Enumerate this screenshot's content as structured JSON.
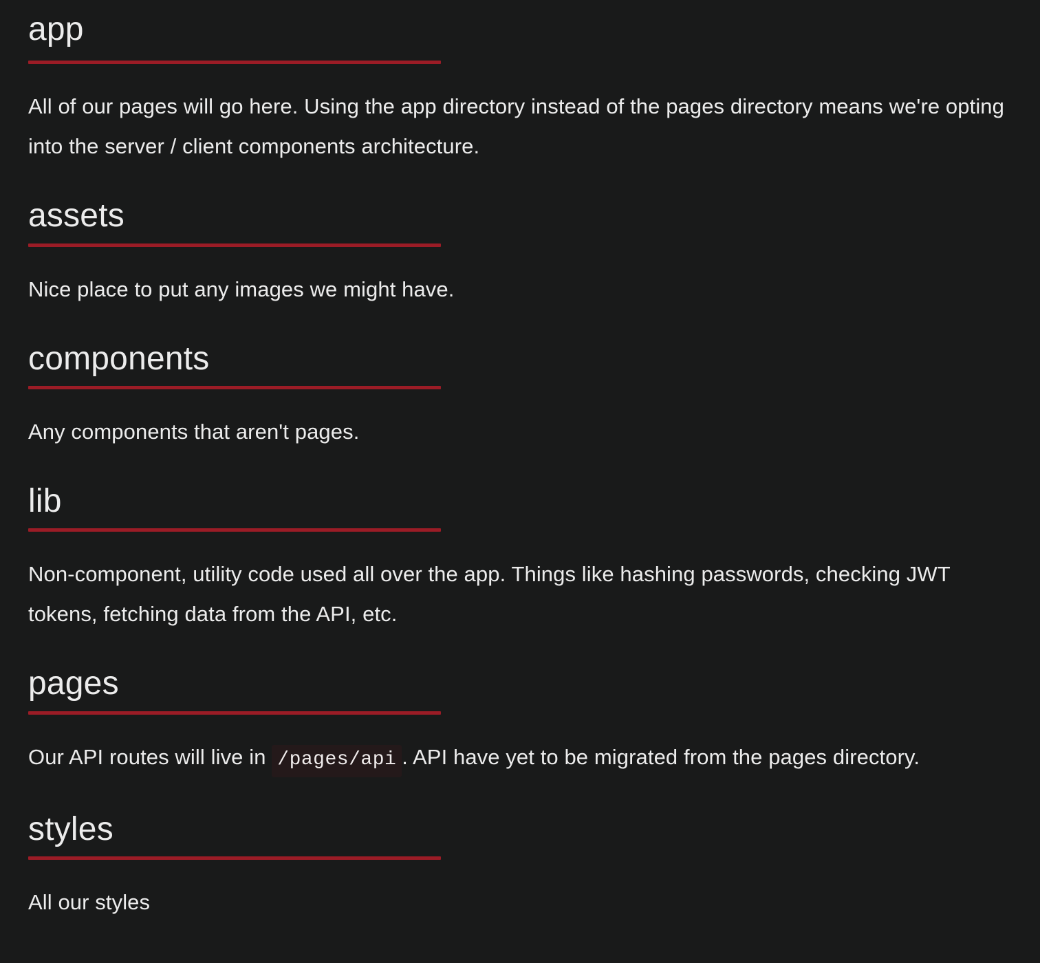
{
  "colors": {
    "background": "#191a1a",
    "text": "#ececec",
    "accent_rule": "#9b1c26",
    "code_background": "#24191a"
  },
  "sections": [
    {
      "title": "app",
      "body": "All of our pages will go here. Using the app directory instead of the pages directory means we're opting into the server / client components architecture."
    },
    {
      "title": "assets",
      "body": "Nice place to put any images we might have."
    },
    {
      "title": "components",
      "body": "Any components that aren't pages."
    },
    {
      "title": "lib",
      "body": "Non-component, utility code used all over the app. Things like hashing passwords, checking JWT tokens, fetching data from the API, etc."
    },
    {
      "title": "pages",
      "body_before": "Our API routes will live in ",
      "body_code": "/pages/api",
      "body_after": ". API have yet to be migrated from the pages directory."
    },
    {
      "title": "styles",
      "body": "All our styles"
    }
  ]
}
